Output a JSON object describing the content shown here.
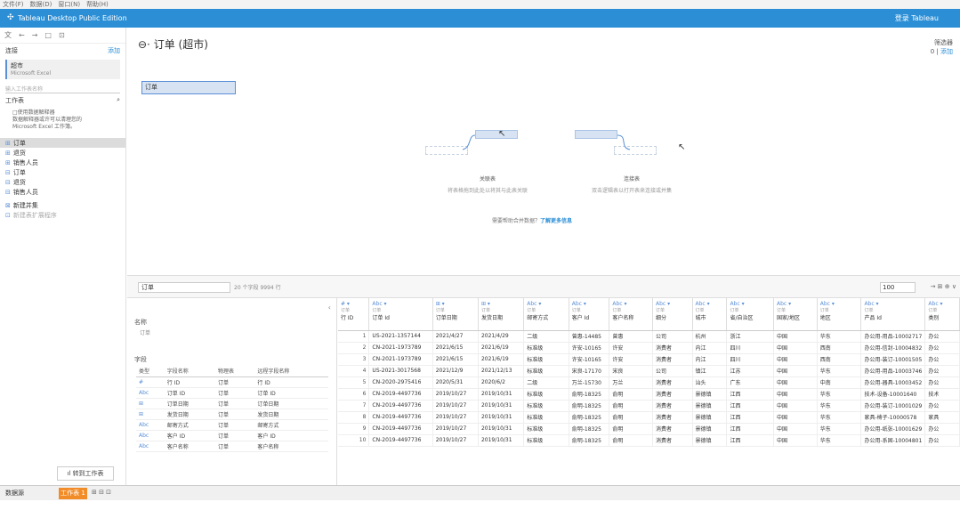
{
  "menubar": [
    "文件(F)",
    "数据(D)",
    "窗口(N)",
    "帮助(H)"
  ],
  "titlebar": {
    "title": "Tableau Desktop Public Edition",
    "signin": "登录 Tableau"
  },
  "left": {
    "toolbar": [
      "文",
      "←",
      "→",
      "□",
      "⊡"
    ],
    "connections_label": "连接",
    "add_label": "添加",
    "connection": {
      "name": "超市",
      "type": "Microsoft Excel"
    },
    "schema_placeholder": "输入工作表名称",
    "sheets_label": "工作表",
    "hint": [
      "□使用数据解释器",
      "数据解释器或许可以清理您的",
      "Microsoft Excel 工作簿。"
    ],
    "sheets": [
      "订单",
      "退货",
      "销售人员",
      "订单",
      "退货",
      "销售人员"
    ],
    "new_union": "新建并集",
    "new_table_ext": "新建表扩展程序"
  },
  "canvas": {
    "heading": "订单 (超市)",
    "filters_label": "筛选器",
    "filters_count": "0",
    "filters_add": "添加",
    "table_label": "订单",
    "relate_title": "关联表",
    "relate_desc": "将表格拖到此处以将其与此表关联",
    "join_title": "连接表",
    "join_desc": "双击逻辑表以打开表来连接或并集",
    "help_text": "需要帮助合并数据？",
    "help_link": "了解更多信息"
  },
  "grid_toolbar": {
    "table": "订单",
    "count": "20 个字段 9994 行",
    "rows": "100"
  },
  "meta": {
    "name_label": "名称",
    "name_value": "订单",
    "fields_label": "字段",
    "headers": [
      "类型",
      "字段名称",
      "物理表",
      "远程字段名称"
    ],
    "rows": [
      [
        "#",
        "行 ID",
        "订单",
        "行 ID"
      ],
      [
        "Abc",
        "订单 ID",
        "订单",
        "订单 ID"
      ],
      [
        "⊞",
        "订单日期",
        "订单",
        "订单日期"
      ],
      [
        "⊞",
        "发货日期",
        "订单",
        "发货日期"
      ],
      [
        "Abc",
        "邮寄方式",
        "订单",
        "邮寄方式"
      ],
      [
        "Abc",
        "客户 ID",
        "订单",
        "客户 ID"
      ],
      [
        "Abc",
        "客户名称",
        "订单",
        "客户名称"
      ]
    ],
    "new_sheet": "转到工作表"
  },
  "grid": {
    "columns": [
      {
        "type": "#",
        "src": "订单",
        "name": "行 ID"
      },
      {
        "type": "Abc",
        "src": "订单",
        "name": "订单 Id"
      },
      {
        "type": "⊞",
        "src": "订单",
        "name": "订单日期"
      },
      {
        "type": "⊞",
        "src": "订单",
        "name": "发货日期"
      },
      {
        "type": "Abc",
        "src": "订单",
        "name": "邮寄方式"
      },
      {
        "type": "Abc",
        "src": "订单",
        "name": "客户 Id"
      },
      {
        "type": "Abc",
        "src": "订单",
        "name": "客户名称"
      },
      {
        "type": "Abc",
        "src": "订单",
        "name": "细分"
      },
      {
        "type": "Abc",
        "src": "订单",
        "name": "城市"
      },
      {
        "type": "Abc",
        "src": "订单",
        "name": "省/自治区"
      },
      {
        "type": "Abc",
        "src": "订单",
        "name": "国家/地区"
      },
      {
        "type": "Abc",
        "src": "订单",
        "name": "地区"
      },
      {
        "type": "Abc",
        "src": "订单",
        "name": "产品 Id"
      },
      {
        "type": "Abc",
        "src": "订单",
        "name": "类别"
      }
    ],
    "rows": [
      [
        "1",
        "US-2021-1357144",
        "2021/4/27",
        "2021/4/29",
        "二级",
        "曾惠-14485",
        "曾惠",
        "公司",
        "杭州",
        "浙江",
        "中国",
        "华东",
        "办公用-用品-10002717",
        "办公"
      ],
      [
        "2",
        "CN-2021-1973789",
        "2021/6/15",
        "2021/6/19",
        "标准级",
        "许安-10165",
        "许安",
        "消费者",
        "内江",
        "四川",
        "中国",
        "西南",
        "办公用-信封-10004832",
        "办公"
      ],
      [
        "3",
        "CN-2021-1973789",
        "2021/6/15",
        "2021/6/19",
        "标准级",
        "许安-10165",
        "许安",
        "消费者",
        "内江",
        "四川",
        "中国",
        "西南",
        "办公用-装订-10001505",
        "办公"
      ],
      [
        "4",
        "US-2021-3017568",
        "2021/12/9",
        "2021/12/13",
        "标准级",
        "宋良-17170",
        "宋良",
        "公司",
        "镇江",
        "江苏",
        "中国",
        "华东",
        "办公用-用品-10003746",
        "办公"
      ],
      [
        "5",
        "CN-2020-2975416",
        "2020/5/31",
        "2020/6/2",
        "二级",
        "万兰-15730",
        "万兰",
        "消费者",
        "汕头",
        "广东",
        "中国",
        "中南",
        "办公用-器具-10003452",
        "办公"
      ],
      [
        "6",
        "CN-2019-4497736",
        "2019/10/27",
        "2019/10/31",
        "标准级",
        "俞明-18325",
        "俞明",
        "消费者",
        "景德镇",
        "江西",
        "中国",
        "华东",
        "技术-设备-10001640",
        "技术"
      ],
      [
        "7",
        "CN-2019-4497736",
        "2019/10/27",
        "2019/10/31",
        "标准级",
        "俞明-18325",
        "俞明",
        "消费者",
        "景德镇",
        "江西",
        "中国",
        "华东",
        "办公用-装订-10001029",
        "办公"
      ],
      [
        "8",
        "CN-2019-4497736",
        "2019/10/27",
        "2019/10/31",
        "标准级",
        "俞明-18325",
        "俞明",
        "消费者",
        "景德镇",
        "江西",
        "中国",
        "华东",
        "家具-椅子-10000578",
        "家具"
      ],
      [
        "9",
        "CN-2019-4497736",
        "2019/10/27",
        "2019/10/31",
        "标准级",
        "俞明-18325",
        "俞明",
        "消费者",
        "景德镇",
        "江西",
        "中国",
        "华东",
        "办公用-纸张-10001629",
        "办公"
      ],
      [
        "10",
        "CN-2019-4497736",
        "2019/10/27",
        "2019/10/31",
        "标准级",
        "俞明-18325",
        "俞明",
        "消费者",
        "景德镇",
        "江西",
        "中国",
        "华东",
        "办公用-系固-10004801",
        "办公"
      ]
    ]
  },
  "status": {
    "source": "数据源",
    "tab": "工作表 1",
    "icons": "⊞ ⊟ ⊡"
  }
}
